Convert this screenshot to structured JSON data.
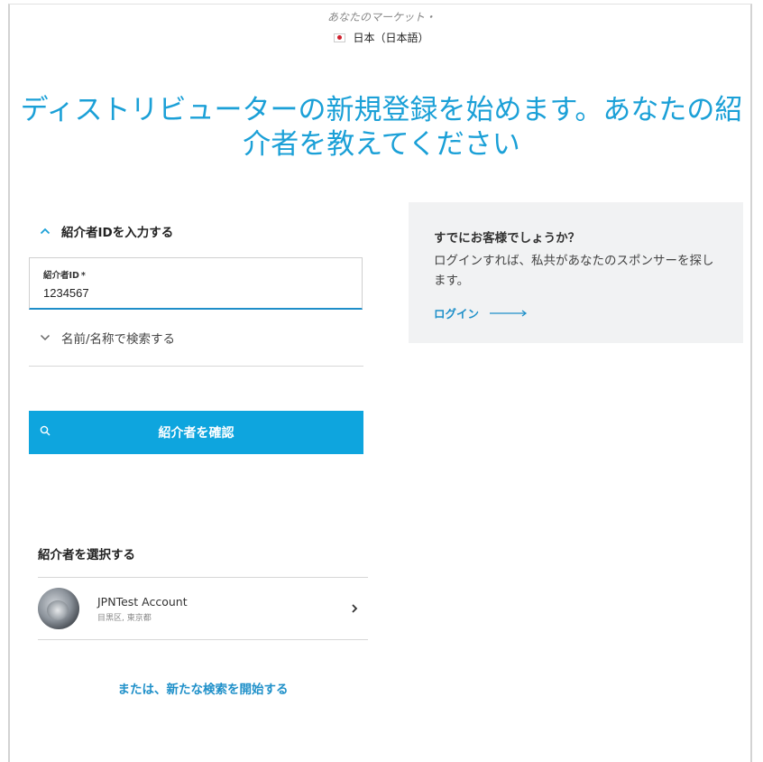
{
  "market": {
    "label": "あなたのマーケット・",
    "value": "日本（日本語）"
  },
  "title": "ディストリビューターの新規登録を始めます。あなたの紹介者を教えてください",
  "sponsor_id_section": {
    "header": "紹介者IDを入力する",
    "field_label": "紹介者ID",
    "required_mark": "*",
    "field_value": "1234567"
  },
  "name_search_section": {
    "header": "名前/名称で検索する"
  },
  "confirm_button": {
    "label": "紹介者を確認"
  },
  "existing_customer": {
    "title": "すでにお客様でしょうか？",
    "text": "ログインすれば、私共があなたのスポンサーを探します。",
    "link": "ログイン"
  },
  "select_sponsor": {
    "title": "紹介者を選択する",
    "results": [
      {
        "name": "JPNTest Account",
        "location": "目黒区, 東京都"
      }
    ],
    "new_search_link": "または、新たな検索を開始する"
  },
  "colors": {
    "accent": "#1ba0d7",
    "button": "#0ea5de",
    "link": "#1f90c9",
    "card_bg": "#f1f2f3"
  },
  "icons": [
    "japan-flag-icon",
    "chevron-up-icon",
    "chevron-down-icon",
    "search-icon",
    "arrow-right-icon",
    "chevron-right-icon"
  ]
}
